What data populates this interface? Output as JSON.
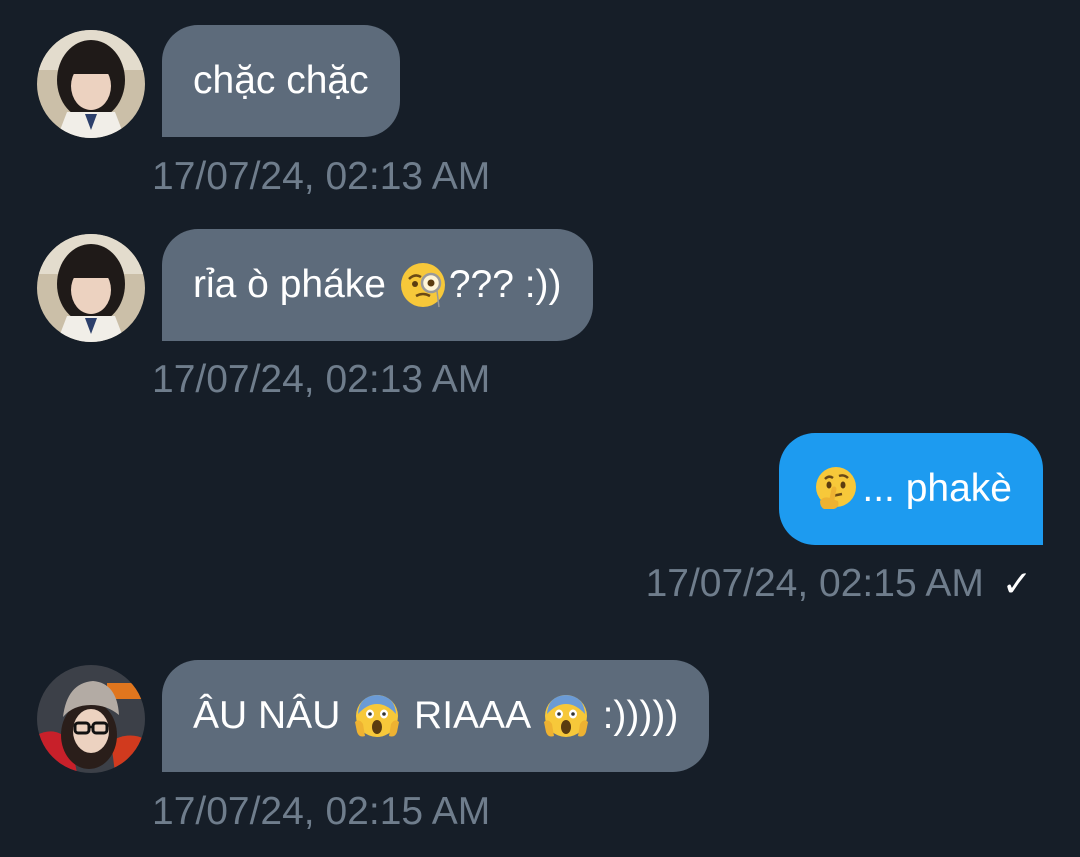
{
  "messages": [
    {
      "direction": "incoming",
      "avatar": "avatar-dark-hair",
      "text": "chặc chặc",
      "timestamp": "17/07/24, 02:13 AM"
    },
    {
      "direction": "incoming",
      "avatar": "avatar-dark-hair",
      "text_before": "rỉa ò pháke ",
      "emoji": "face-with-monocle-icon",
      "text_after": "??? :))",
      "timestamp": "17/07/24, 02:13 AM"
    },
    {
      "direction": "outgoing",
      "emoji": "thinking-face-icon",
      "text_after": "... phakè",
      "timestamp": "17/07/24, 02:15 AM",
      "status_icon": "check-icon",
      "status_glyph": "✓"
    },
    {
      "direction": "incoming",
      "avatar": "avatar-beanie",
      "text_before": "ÂU NÂU ",
      "emoji": "face-screaming-in-fear-icon",
      "text_middle": " RIAAA ",
      "emoji_2": "face-screaming-in-fear-icon",
      "text_after": " :)))))",
      "timestamp": "17/07/24, 02:15 AM"
    }
  ],
  "colors": {
    "background": "#161e28",
    "incoming_bubble": "#5d6b7b",
    "outgoing_bubble": "#1d9bf0",
    "timestamp": "#6f7d8c"
  }
}
